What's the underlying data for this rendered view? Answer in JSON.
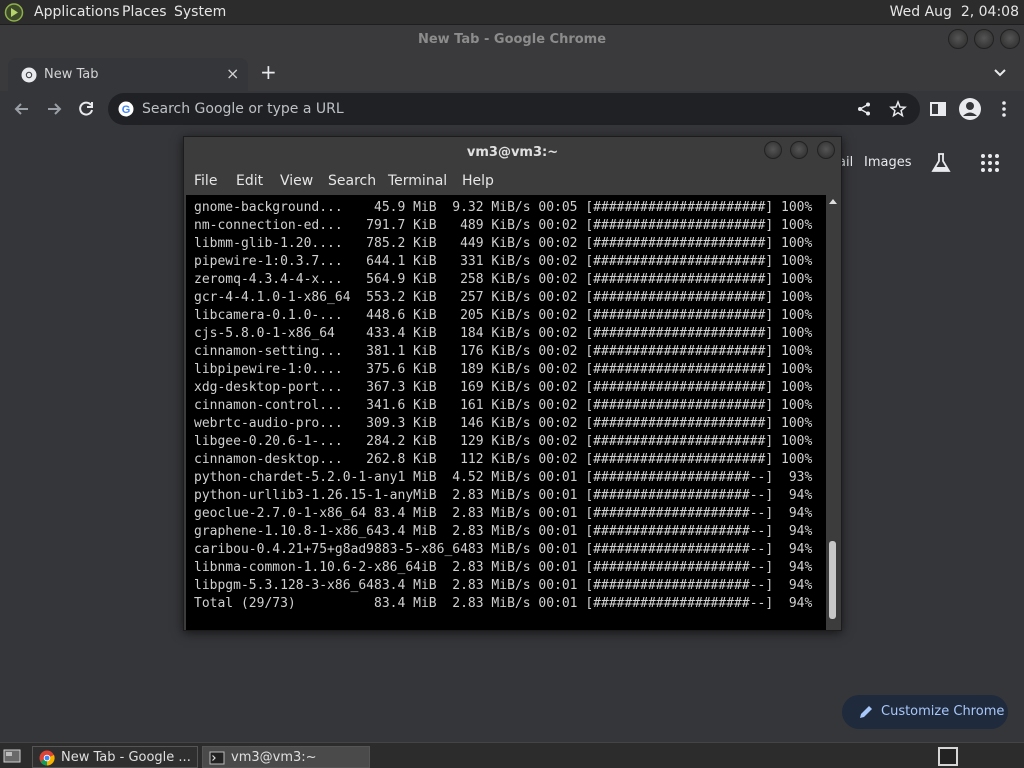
{
  "top_panel": {
    "menus": [
      "Applications",
      "Places",
      "System"
    ],
    "clock": "Wed Aug  2, 04:08"
  },
  "chrome": {
    "window_title": "New Tab - Google Chrome",
    "tab_title": "New Tab",
    "tab_close": "×",
    "new_tab": "+",
    "omnibox_placeholder": "Search Google or type a URL",
    "ntp": {
      "gmail_fragment": "ail",
      "images": "Images",
      "customize_label": "Customize Chrome"
    }
  },
  "terminal": {
    "title": "vm3@vm3:~",
    "menu": [
      "File",
      "Edit",
      "View",
      "Search",
      "Terminal",
      "Help"
    ],
    "lines": [
      "gnome-background...    45.9 MiB  9.32 MiB/s 00:05 [######################] 100%",
      "nm-connection-ed...   791.7 KiB   489 KiB/s 00:02 [######################] 100%",
      "libmm-glib-1.20....   785.2 KiB   449 KiB/s 00:02 [######################] 100%",
      "pipewire-1:0.3.7...   644.1 KiB   331 KiB/s 00:02 [######################] 100%",
      "zeromq-4.3.4-4-x...   564.9 KiB   258 KiB/s 00:02 [######################] 100%",
      "gcr-4-4.1.0-1-x86_64  553.2 KiB   257 KiB/s 00:02 [######################] 100%",
      "libcamera-0.1.0-...   448.6 KiB   205 KiB/s 00:02 [######################] 100%",
      "cjs-5.8.0-1-x86_64    433.4 KiB   184 KiB/s 00:02 [######################] 100%",
      "cinnamon-setting...   381.1 KiB   176 KiB/s 00:02 [######################] 100%",
      "libpipewire-1:0....   375.6 KiB   189 KiB/s 00:02 [######################] 100%",
      "xdg-desktop-port...   367.3 KiB   169 KiB/s 00:02 [######################] 100%",
      "cinnamon-control...   341.6 KiB   161 KiB/s 00:02 [######################] 100%",
      "webrtc-audio-pro...   309.3 KiB   146 KiB/s 00:02 [######################] 100%",
      "libgee-0.20.6-1-...   284.2 KiB   129 KiB/s 00:02 [######################] 100%",
      "cinnamon-desktop...   262.8 KiB   112 KiB/s 00:02 [######################] 100%",
      "python-chardet-5.2.0-1-any1 MiB  4.52 MiB/s 00:01 [####################--]  93%",
      "python-urllib3-1.26.15-1-anyMiB  2.83 MiB/s 00:01 [####################--]  94%",
      "geoclue-2.7.0-1-x86_64 83.4 MiB  2.83 MiB/s 00:01 [####################--]  94%",
      "graphene-1.10.8-1-x86_643.4 MiB  2.83 MiB/s 00:01 [####################--]  94%",
      "caribou-0.4.21+75+g8ad9883-5-x86_6483 MiB/s 00:01 [####################--]  94%",
      "libnma-common-1.10.6-2-x86_64iB  2.83 MiB/s 00:01 [####################--]  94%",
      "libpgm-5.3.128-3-x86_6483.4 MiB  2.83 MiB/s 00:01 [####################--]  94%",
      "Total (29/73)          83.4 MiB  2.83 MiB/s 00:01 [####################--]  94%"
    ]
  },
  "taskbar": {
    "chrome_label": "New Tab - Google ...",
    "terminal_label": "vm3@vm3:~"
  },
  "colors": {
    "chrome_bg": "#35363a",
    "panel_bg": "#2c2c2c",
    "terminal_bg": "#000000",
    "accent_blue": "#a8c7fa"
  }
}
